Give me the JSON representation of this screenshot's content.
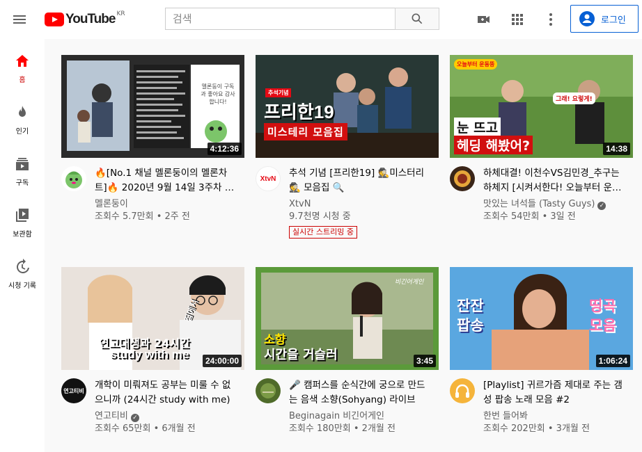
{
  "header": {
    "logo_text": "YouTube",
    "region": "KR",
    "search_placeholder": "검색",
    "login_label": "로그인"
  },
  "sidebar": {
    "items": [
      {
        "label": "홈",
        "icon": "home-icon"
      },
      {
        "label": "인기",
        "icon": "trending-icon"
      },
      {
        "label": "구독",
        "icon": "subscriptions-icon"
      },
      {
        "label": "보관함",
        "icon": "library-icon"
      },
      {
        "label": "시청 기록",
        "icon": "history-icon"
      }
    ]
  },
  "videos": [
    {
      "title": "🔥[No.1 채널 멜론둥이의 멜론차트]🔥 2020년 9월 14일 3주차 멜론차트",
      "channel": "멜론둥이",
      "stats": "조회수 5.7만회 • 2주 전",
      "duration": "4:12:36",
      "verified": false,
      "live": ""
    },
    {
      "title": "추석 기념 [프리한19] 🕵️미스터리🕵️ 모음집 🔍",
      "channel": "XtvN",
      "stats": "9.7천명 시청 중",
      "duration": "",
      "verified": false,
      "live": "실시간 스트리밍 중"
    },
    {
      "title": "하체대결! 이천수VS김민경_추구는 하체지 [시켜서한다! 오늘부터 운동뚱]",
      "channel": "맛있는 녀석들 (Tasty Guys)",
      "stats": "조회수 54만회 • 3일 전",
      "duration": "14:38",
      "verified": true,
      "live": ""
    },
    {
      "title": "개학이 미뤄져도 공부는 미룰 수 없으니까 (24시간 study with me)",
      "channel": "연고티비",
      "stats": "조회수 65만회 • 6개월 전",
      "duration": "24:00:00",
      "verified": true,
      "live": ""
    },
    {
      "title": "🎤 캠퍼스를 순식간에 궁으로 만드는 음색 소향(Sohyang) 라이브",
      "channel": "Beginagain 비긴어게인",
      "stats": "조회수 180만회 • 2개월 전",
      "duration": "3:45",
      "verified": false,
      "live": ""
    },
    {
      "title": "[Playlist] 귀르가즘 제대로 주는 갬성 팝송 노래 모음 #2",
      "channel": "한번 들어봐",
      "stats": "조회수 202만회 • 3개월 전",
      "duration": "1:06:24",
      "verified": false,
      "live": ""
    }
  ],
  "thumb_text": {
    "v1": "멜론둥이 구독과 좋아요 감사합니다!",
    "v2_badge": "추석기념",
    "v2_line1": "프리한19",
    "v2_line2": "미스테리 모음집",
    "v3_badge": "오늘부터 운동뚱",
    "v3_bubble": "그래! 요렇게!",
    "v3_line1": "눈 뜨고",
    "v3_line2": "헤딩 해봤어?",
    "v4_line1": "연고대생과 24시간",
    "v4_line2": "study with me",
    "v4_side": "집에서",
    "v5_line1": "소향",
    "v5_line2": "시간을 거슬러",
    "v5_tag": "비긴어게인",
    "v6_left": "잔잔 팝송",
    "v6_right": "띵곡 모음"
  },
  "avatars": {
    "v2": "XtvN",
    "v4": "연고티비"
  },
  "colors": {
    "brand_red": "#ff0000",
    "link_blue": "#065fd4",
    "live_red": "#cc0000"
  }
}
